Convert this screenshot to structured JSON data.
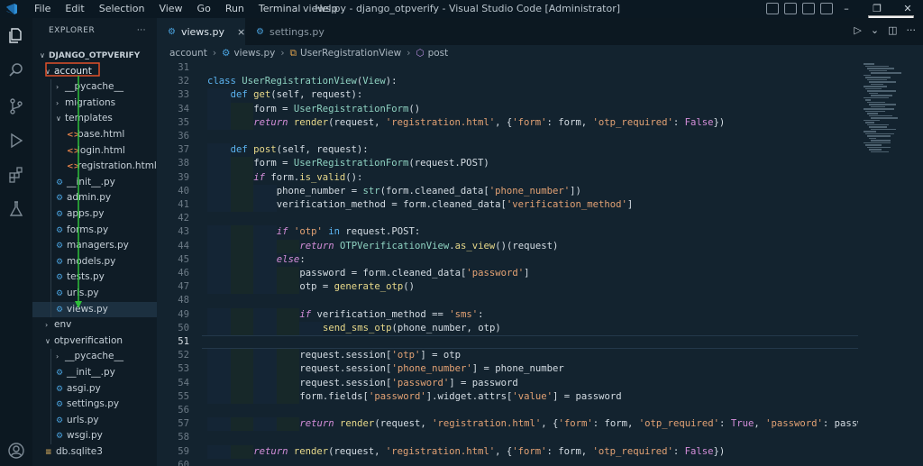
{
  "titlebar": {
    "menu": [
      "File",
      "Edit",
      "Selection",
      "View",
      "Go",
      "Run",
      "Terminal",
      "Help"
    ],
    "title": "views.py - django_otpverify - Visual Studio Code [Administrator]",
    "tooltip": "minimize"
  },
  "activitybar": {
    "icons": [
      "explorer-icon",
      "search-icon",
      "source-control-icon",
      "run-debug-icon",
      "extensions-icon",
      "testing-icon",
      "accounts-icon"
    ]
  },
  "sidebar": {
    "header": "EXPLORER",
    "more": "···",
    "tree": [
      {
        "label": "DJANGO_OTPVERIFY",
        "depth": 0,
        "kind": "root",
        "chev": "∨"
      },
      {
        "label": "account",
        "depth": 1,
        "kind": "folder",
        "chev": "∨",
        "highlight": true
      },
      {
        "label": "__pycache__",
        "depth": 2,
        "kind": "folder",
        "chev": "›"
      },
      {
        "label": "migrations",
        "depth": 2,
        "kind": "folder",
        "chev": "›"
      },
      {
        "label": "templates",
        "depth": 2,
        "kind": "folder",
        "chev": "∨"
      },
      {
        "label": "base.html",
        "depth": 3,
        "kind": "html"
      },
      {
        "label": "login.html",
        "depth": 3,
        "kind": "html"
      },
      {
        "label": "registration.html",
        "depth": 3,
        "kind": "html"
      },
      {
        "label": "__init__.py",
        "depth": 2,
        "kind": "py"
      },
      {
        "label": "admin.py",
        "depth": 2,
        "kind": "py"
      },
      {
        "label": "apps.py",
        "depth": 2,
        "kind": "py"
      },
      {
        "label": "forms.py",
        "depth": 2,
        "kind": "py"
      },
      {
        "label": "managers.py",
        "depth": 2,
        "kind": "py"
      },
      {
        "label": "models.py",
        "depth": 2,
        "kind": "py"
      },
      {
        "label": "tests.py",
        "depth": 2,
        "kind": "py"
      },
      {
        "label": "urls.py",
        "depth": 2,
        "kind": "py"
      },
      {
        "label": "views.py",
        "depth": 2,
        "kind": "py",
        "selected": true
      },
      {
        "label": "env",
        "depth": 1,
        "kind": "folder",
        "chev": "›"
      },
      {
        "label": "otpverification",
        "depth": 1,
        "kind": "folder",
        "chev": "∨"
      },
      {
        "label": "__pycache__",
        "depth": 2,
        "kind": "folder",
        "chev": "›"
      },
      {
        "label": "__init__.py",
        "depth": 2,
        "kind": "py"
      },
      {
        "label": "asgi.py",
        "depth": 2,
        "kind": "py"
      },
      {
        "label": "settings.py",
        "depth": 2,
        "kind": "py"
      },
      {
        "label": "urls.py",
        "depth": 2,
        "kind": "py"
      },
      {
        "label": "wsgi.py",
        "depth": 2,
        "kind": "py"
      },
      {
        "label": "db.sqlite3",
        "depth": 1,
        "kind": "db"
      }
    ]
  },
  "tabs": [
    {
      "label": "views.py",
      "active": true,
      "close": "×"
    },
    {
      "label": "settings.py",
      "active": false
    }
  ],
  "breadcrumb": [
    "account",
    "views.py",
    "UserRegistrationView",
    "post"
  ],
  "editor": {
    "current_line": 51,
    "lines": [
      {
        "n": 31,
        "indent": 0,
        "tokens": []
      },
      {
        "n": 32,
        "indent": 0,
        "tokens": [
          [
            "k",
            "class "
          ],
          [
            "cn",
            "UserRegistrationView"
          ],
          [
            "p",
            "("
          ],
          [
            "cn",
            "View"
          ],
          [
            "p",
            "):"
          ]
        ]
      },
      {
        "n": 33,
        "indent": 1,
        "tokens": [
          [
            "k",
            "def "
          ],
          [
            "fn",
            "get"
          ],
          [
            "p",
            "(self, request):"
          ]
        ]
      },
      {
        "n": 34,
        "indent": 2,
        "tokens": [
          [
            "p",
            "form = "
          ],
          [
            "cn",
            "UserRegistrationForm"
          ],
          [
            "p",
            "()"
          ]
        ]
      },
      {
        "n": 35,
        "indent": 2,
        "tokens": [
          [
            "kc",
            "return "
          ],
          [
            "fn",
            "render"
          ],
          [
            "p",
            "(request, "
          ],
          [
            "st",
            "'registration.html'"
          ],
          [
            "p",
            ", {"
          ],
          [
            "st",
            "'form'"
          ],
          [
            "p",
            ": form, "
          ],
          [
            "st",
            "'otp_required'"
          ],
          [
            "p",
            ": "
          ],
          [
            "bo",
            "False"
          ],
          [
            "p",
            "})"
          ]
        ]
      },
      {
        "n": 36,
        "indent": 0,
        "tokens": []
      },
      {
        "n": 37,
        "indent": 1,
        "tokens": [
          [
            "k",
            "def "
          ],
          [
            "fn",
            "post"
          ],
          [
            "p",
            "(self, request):"
          ]
        ]
      },
      {
        "n": 38,
        "indent": 2,
        "tokens": [
          [
            "p",
            "form = "
          ],
          [
            "cn",
            "UserRegistrationForm"
          ],
          [
            "p",
            "(request.POST)"
          ]
        ]
      },
      {
        "n": 39,
        "indent": 2,
        "tokens": [
          [
            "kc",
            "if "
          ],
          [
            "p",
            "form."
          ],
          [
            "fn",
            "is_valid"
          ],
          [
            "p",
            "():"
          ]
        ]
      },
      {
        "n": 40,
        "indent": 3,
        "tokens": [
          [
            "p",
            "phone_number = "
          ],
          [
            "cn",
            "str"
          ],
          [
            "p",
            "(form.cleaned_data["
          ],
          [
            "st",
            "'phone_number'"
          ],
          [
            "p",
            "])"
          ]
        ]
      },
      {
        "n": 41,
        "indent": 3,
        "tokens": [
          [
            "p",
            "verification_method = form.cleaned_data["
          ],
          [
            "st",
            "'verification_method'"
          ],
          [
            "p",
            "]"
          ]
        ]
      },
      {
        "n": 42,
        "indent": 0,
        "tokens": []
      },
      {
        "n": 43,
        "indent": 3,
        "tokens": [
          [
            "kc",
            "if "
          ],
          [
            "st",
            "'otp'"
          ],
          [
            "k",
            " in "
          ],
          [
            "p",
            "request.POST:"
          ]
        ]
      },
      {
        "n": 44,
        "indent": 4,
        "tokens": [
          [
            "kc",
            "return "
          ],
          [
            "cn",
            "OTPVerificationView"
          ],
          [
            "p",
            "."
          ],
          [
            "fn",
            "as_view"
          ],
          [
            "p",
            "()(request)"
          ]
        ]
      },
      {
        "n": 45,
        "indent": 3,
        "tokens": [
          [
            "kc",
            "else"
          ],
          [
            "p",
            ":"
          ]
        ]
      },
      {
        "n": 46,
        "indent": 4,
        "tokens": [
          [
            "p",
            "password = form.cleaned_data["
          ],
          [
            "st",
            "'password'"
          ],
          [
            "p",
            "]"
          ]
        ]
      },
      {
        "n": 47,
        "indent": 4,
        "tokens": [
          [
            "p",
            "otp = "
          ],
          [
            "fn",
            "generate_otp"
          ],
          [
            "p",
            "()"
          ]
        ]
      },
      {
        "n": 48,
        "indent": 0,
        "tokens": []
      },
      {
        "n": 49,
        "indent": 4,
        "tokens": [
          [
            "kc",
            "if "
          ],
          [
            "p",
            "verification_method == "
          ],
          [
            "st",
            "'sms'"
          ],
          [
            "p",
            ":"
          ]
        ]
      },
      {
        "n": 50,
        "indent": 5,
        "tokens": [
          [
            "fn",
            "send_sms_otp"
          ],
          [
            "p",
            "(phone_number, otp)"
          ]
        ]
      },
      {
        "n": 51,
        "indent": 0,
        "tokens": []
      },
      {
        "n": 52,
        "indent": 4,
        "tokens": [
          [
            "p",
            "request.session["
          ],
          [
            "st",
            "'otp'"
          ],
          [
            "p",
            "] = otp"
          ]
        ]
      },
      {
        "n": 53,
        "indent": 4,
        "tokens": [
          [
            "p",
            "request.session["
          ],
          [
            "st",
            "'phone_number'"
          ],
          [
            "p",
            "] = phone_number"
          ]
        ]
      },
      {
        "n": 54,
        "indent": 4,
        "tokens": [
          [
            "p",
            "request.session["
          ],
          [
            "st",
            "'password'"
          ],
          [
            "p",
            "] = password"
          ]
        ]
      },
      {
        "n": 55,
        "indent": 4,
        "tokens": [
          [
            "p",
            "form.fields["
          ],
          [
            "st",
            "'password'"
          ],
          [
            "p",
            "].widget.attrs["
          ],
          [
            "st",
            "'value'"
          ],
          [
            "p",
            "] = password"
          ]
        ]
      },
      {
        "n": 56,
        "indent": 0,
        "tokens": []
      },
      {
        "n": 57,
        "indent": 4,
        "tokens": [
          [
            "kc",
            "return "
          ],
          [
            "fn",
            "render"
          ],
          [
            "p",
            "(request, "
          ],
          [
            "st",
            "'registration.html'"
          ],
          [
            "p",
            ", {"
          ],
          [
            "st",
            "'form'"
          ],
          [
            "p",
            ": form, "
          ],
          [
            "st",
            "'otp_required'"
          ],
          [
            "p",
            ": "
          ],
          [
            "bo",
            "True"
          ],
          [
            "p",
            ", "
          ],
          [
            "st",
            "'password'"
          ],
          [
            "p",
            ": password"
          ]
        ]
      },
      {
        "n": 58,
        "indent": 0,
        "tokens": []
      },
      {
        "n": 59,
        "indent": 2,
        "tokens": [
          [
            "kc",
            "return "
          ],
          [
            "fn",
            "render"
          ],
          [
            "p",
            "(request, "
          ],
          [
            "st",
            "'registration.html'"
          ],
          [
            "p",
            ", {"
          ],
          [
            "st",
            "'form'"
          ],
          [
            "p",
            ": form, "
          ],
          [
            "st",
            "'otp_required'"
          ],
          [
            "p",
            ": "
          ],
          [
            "bo",
            "False"
          ],
          [
            "p",
            "})"
          ]
        ]
      },
      {
        "n": 60,
        "indent": 0,
        "tokens": []
      }
    ]
  },
  "colors": {
    "accent": "#4aa3df",
    "highlight_box": "#e0502a",
    "arrow": "#2fbf3a"
  }
}
